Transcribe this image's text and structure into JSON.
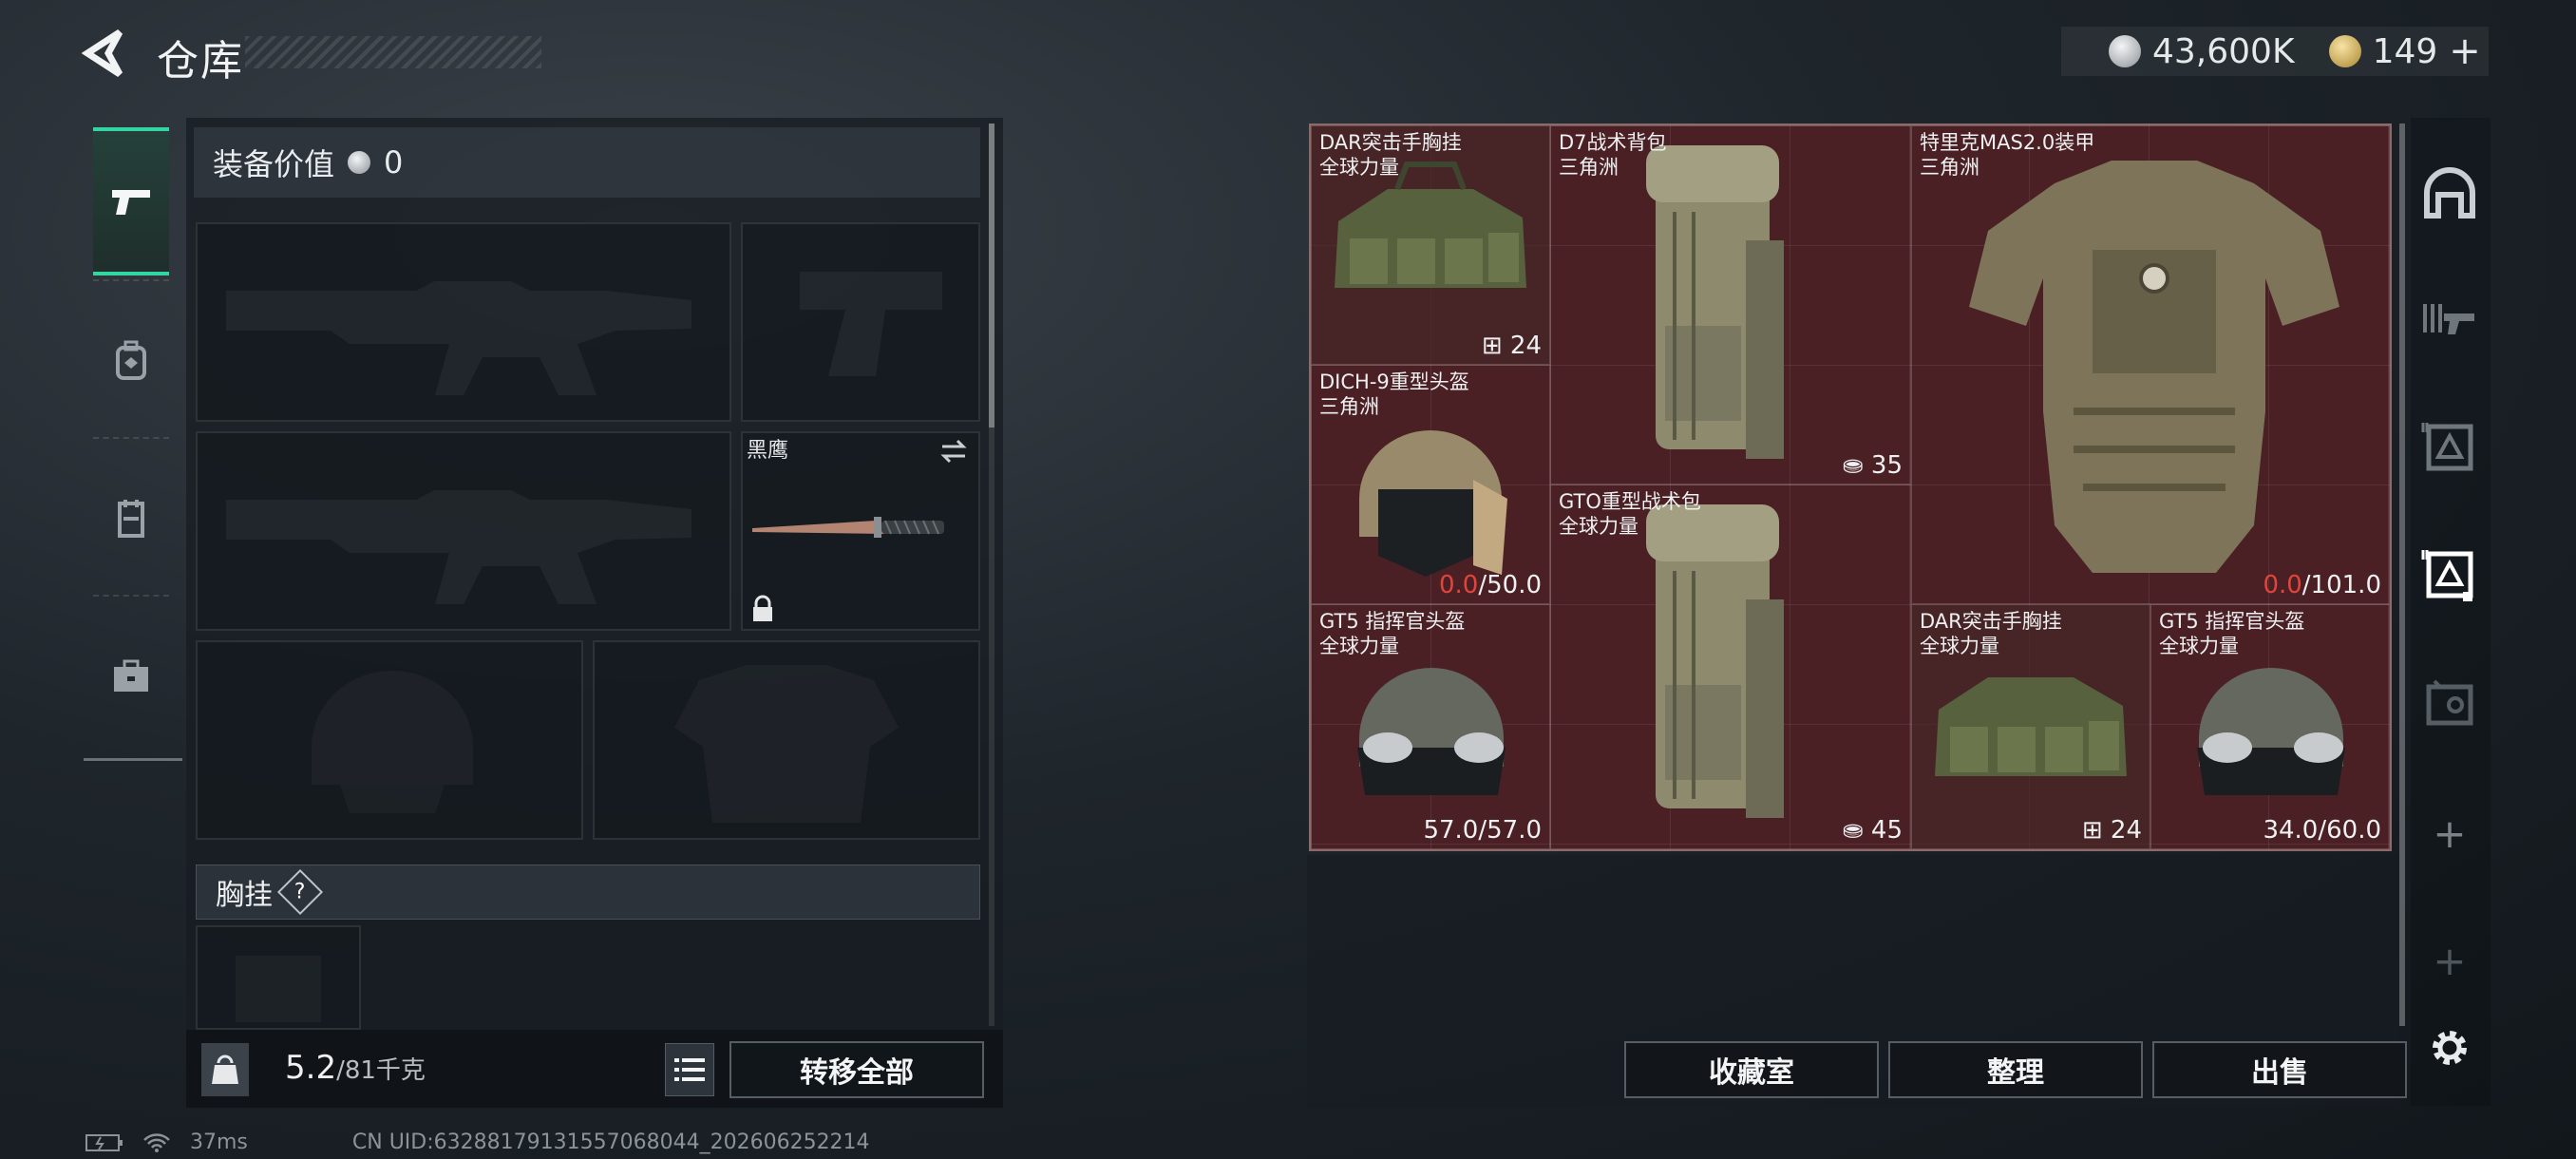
{
  "header": {
    "title": "仓库",
    "currency": {
      "silver": "43,600K",
      "gold": "149",
      "add": "+"
    }
  },
  "left_nav": {
    "items": [
      "pistol-icon",
      "backpack-icon",
      "armor-vest-icon",
      "briefcase-icon"
    ],
    "active": 0
  },
  "loadout": {
    "gear_value_label": "装备价值",
    "gear_value": "0",
    "knife": {
      "name": "黑鹰"
    },
    "chest_rig_label": "胸挂",
    "help": "?"
  },
  "footer_left": {
    "weight_current": "5.2",
    "weight_max": "/81千克",
    "transfer_all": "转移全部"
  },
  "status": {
    "ping": "37ms",
    "uid": "CN UID:6328817913155706804​4_202606252214"
  },
  "container": {
    "items": [
      {
        "name": "DAR突击手胸挂",
        "sub": "全球力量",
        "value": "24",
        "icon": "vest-icon"
      },
      {
        "name": "D7战术背包",
        "sub": "三角洲",
        "value": "35",
        "icon": "backpack-icon"
      },
      {
        "name": "特里克MAS2.0装甲",
        "sub": "三角洲",
        "value_red": "0.0",
        "value": "/101.0"
      },
      {
        "name": "DICH-9重型头盔",
        "sub": "三角洲",
        "value_red": "0.0",
        "value": "/50.0"
      },
      {
        "name": "GTO重型战术包",
        "sub": "全球力量",
        "value": "45",
        "icon": "backpack-icon"
      },
      {
        "name": "GT5 指挥官头盔",
        "sub": "全球力量",
        "value": "57.0/57.0"
      },
      {
        "name": "DAR突击手胸挂",
        "sub": "全球力量",
        "value": "24",
        "icon": "vest-icon"
      },
      {
        "name": "GT5 指挥官头盔",
        "sub": "全球力量",
        "value": "34.0/60.0"
      }
    ]
  },
  "actions": {
    "collection": "收藏室",
    "sort": "整理",
    "sell": "出售"
  },
  "right_nav": {
    "items": [
      "dome-icon",
      "weapon-rack-icon",
      "crate-icon",
      "crate-active-icon",
      "vault-icon",
      "plus-icon",
      "plus-icon",
      "settings-icon"
    ],
    "active": 3
  },
  "colors": {
    "accent": "#33d6a3",
    "container_bg": "#4a2025",
    "durability_low": "#e0443b"
  }
}
